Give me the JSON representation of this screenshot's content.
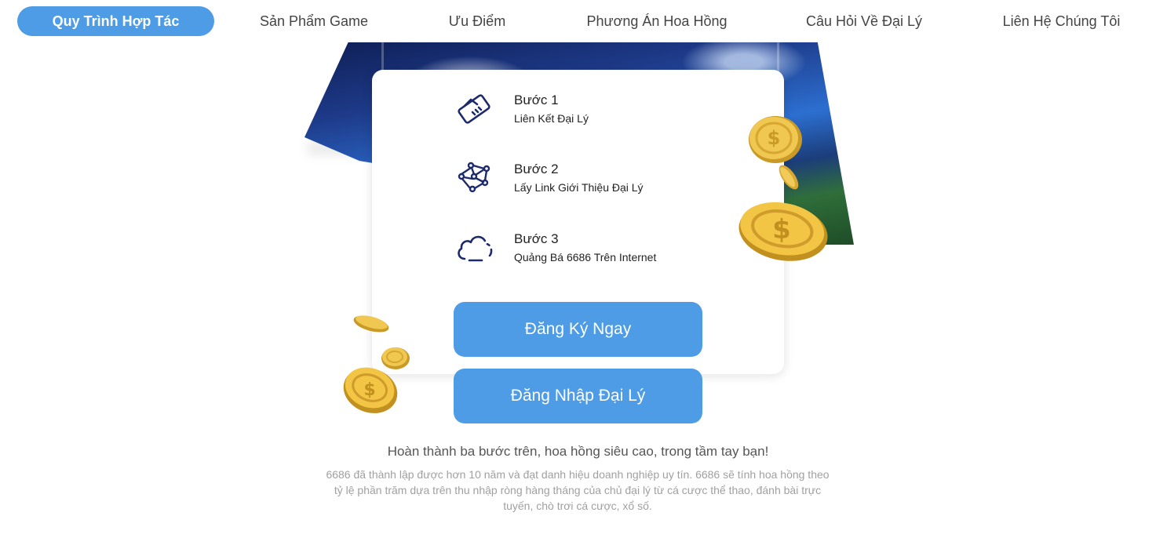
{
  "nav": {
    "items": [
      {
        "label": "Quy Trình Hợp Tác",
        "active": true
      },
      {
        "label": "Sản Phẩm Game",
        "active": false
      },
      {
        "label": "Ưu Điểm",
        "active": false
      },
      {
        "label": "Phương Án Hoa Hồng",
        "active": false
      },
      {
        "label": "Câu Hỏi Về Đại Lý",
        "active": false
      },
      {
        "label": "Liên Hệ Chúng Tôi",
        "active": false
      }
    ]
  },
  "steps": [
    {
      "title": "Bước 1",
      "desc": "Liên Kết Đại Lý",
      "icon": "handshake-icon"
    },
    {
      "title": "Bước 2",
      "desc": "Lấy Link Giới Thiệu Đại Lý",
      "icon": "network-icon"
    },
    {
      "title": "Bước 3",
      "desc": "Quảng Bá 6686 Trên Internet",
      "icon": "cloud-icon"
    }
  ],
  "buttons": {
    "register": "Đăng Ký Ngay",
    "login": "Đăng Nhập Đại Lý"
  },
  "footer": {
    "headline": "Hoàn thành ba bước trên, hoa hồng siêu cao, trong tầm tay bạn!",
    "description": "6686 đã thành lập được hơn 10 năm và đạt danh hiệu doanh nghiệp uy tín. 6686 sẽ tính hoa hồng theo tỷ lệ phần trăm dựa trên thu nhập ròng hàng tháng của chủ đại lý từ cá cược thể thao, đánh bài trực tuyến, chò trơi cá cược, xổ số."
  },
  "colors": {
    "accent": "#4e9be6",
    "icon": "#1d2a6b",
    "coin": "#e3b43a"
  }
}
